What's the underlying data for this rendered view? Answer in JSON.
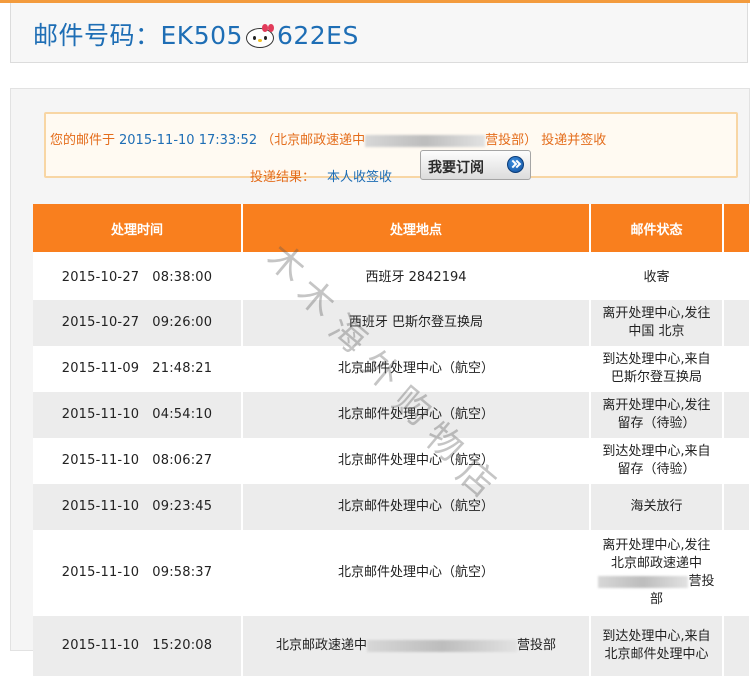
{
  "header": {
    "title_prefix": "邮件号码：",
    "tracking_part1": "EK505",
    "tracking_part2": "622ES"
  },
  "result": {
    "line1_prefix": "您的邮件于",
    "delivered_datetime": "2015-11-10 17:33:52",
    "office_part1": "（北京邮政速递中",
    "office_part2": "营投部）",
    "line1_suffix": "投递并签收",
    "line2_label": "投递结果：",
    "line2_value": "本人收签收",
    "subscribe_button": "我要订阅"
  },
  "table": {
    "headers": [
      "处理时间",
      "处理地点",
      "邮件状态"
    ],
    "rows": [
      {
        "time": "2015-10-27   08:38:00",
        "place": "西班牙  2842194",
        "status": "收寄"
      },
      {
        "time": "2015-10-27   09:26:00",
        "place": "西班牙  巴斯尔登互换局",
        "status": "离开处理中心,发往中国  北京"
      },
      {
        "time": "2015-11-09   21:48:21",
        "place": "北京邮件处理中心（航空）",
        "status": "到达处理中心,来自巴斯尔登互换局"
      },
      {
        "time": "2015-11-10   04:54:10",
        "place": "北京邮件处理中心（航空）",
        "status": "离开处理中心,发往留存（待验）"
      },
      {
        "time": "2015-11-10   08:06:27",
        "place": "北京邮件处理中心（航空）",
        "status": "到达处理中心,来自留存（待验）"
      },
      {
        "time": "2015-11-10   09:23:45",
        "place": "北京邮件处理中心（航空）",
        "status": "海关放行"
      },
      {
        "time": "2015-11-10   09:58:37",
        "place": "北京邮件处理中心（航空）",
        "status_part1": "离开处理中心,发往北京邮政速递中",
        "status_part2": "营投部"
      },
      {
        "time": "2015-11-10   15:20:08",
        "place_part1": "北京邮政速递中",
        "place_part2": "营投部",
        "status": "到达处理中心,来自北京邮件处理中心"
      }
    ]
  },
  "watermark": [
    "木",
    "木",
    "海",
    "外",
    "购",
    "物",
    "店"
  ],
  "colors": {
    "accent_orange": "#f97f1e",
    "link_blue": "#1e6eb5",
    "text_orange": "#e46d1c"
  }
}
